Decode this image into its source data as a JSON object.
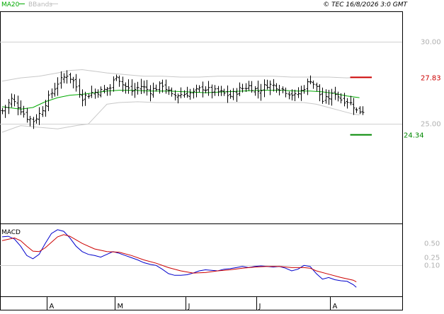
{
  "header": {
    "ma_legend": "MA20",
    "bbands_legend": "BBands",
    "copyright": "© TEC 16/8/2026 3:0 GMT"
  },
  "colors": {
    "ma": "#00aa00",
    "bbands": "#c8c8c8",
    "bars": "#000000",
    "resistance": "#cc0000",
    "support": "#008800",
    "macd": "#0000cc",
    "signal": "#cc0000",
    "grid": "#d0d0d0",
    "axis_text": "#b0b0b0"
  },
  "chart_data": [
    {
      "type": "ohlc",
      "y_ticks": [
        "30.00",
        "25.00"
      ],
      "ylim": [
        19.0,
        31.8
      ],
      "month_labels": [
        "A",
        "M",
        "J",
        "J",
        "A"
      ],
      "month_positions": [
        14.5,
        36.5,
        59.5,
        82.5,
        106.5
      ],
      "bar_count": 118,
      "resistance": {
        "value": 27.83,
        "label": "27.83",
        "from_index": 113,
        "to_index": 120
      },
      "support": {
        "value": 24.34,
        "label": "24.34",
        "from_index": 113,
        "to_index": 120
      },
      "ma20": [
        [
          0,
          26.05
        ],
        [
          6,
          25.9
        ],
        [
          10,
          26.0
        ],
        [
          14,
          26.35
        ],
        [
          18,
          26.6
        ],
        [
          22,
          26.75
        ],
        [
          26,
          26.8
        ],
        [
          30,
          26.9
        ],
        [
          34,
          27.0
        ],
        [
          38,
          27.05
        ],
        [
          42,
          27.05
        ],
        [
          48,
          27.0
        ],
        [
          54,
          27.0
        ],
        [
          60,
          26.95
        ],
        [
          66,
          26.9
        ],
        [
          72,
          26.95
        ],
        [
          78,
          27.0
        ],
        [
          84,
          27.05
        ],
        [
          90,
          27.05
        ],
        [
          96,
          27.0
        ],
        [
          100,
          27.0
        ],
        [
          104,
          26.95
        ],
        [
          108,
          26.85
        ],
        [
          112,
          26.7
        ],
        [
          116,
          26.6
        ]
      ],
      "bb_upper": [
        [
          0,
          27.6
        ],
        [
          6,
          27.8
        ],
        [
          12,
          27.9
        ],
        [
          18,
          28.1
        ],
        [
          22,
          28.25
        ],
        [
          26,
          28.3
        ],
        [
          30,
          28.2
        ],
        [
          34,
          28.1
        ],
        [
          40,
          28.0
        ],
        [
          46,
          27.9
        ],
        [
          52,
          27.9
        ],
        [
          58,
          27.85
        ],
        [
          64,
          27.85
        ],
        [
          70,
          27.9
        ],
        [
          76,
          27.9
        ],
        [
          82,
          27.9
        ],
        [
          88,
          27.9
        ],
        [
          94,
          27.85
        ],
        [
          100,
          27.85
        ],
        [
          106,
          27.85
        ],
        [
          112,
          27.8
        ],
        [
          116,
          27.85
        ]
      ],
      "bb_lower": [
        [
          0,
          24.5
        ],
        [
          6,
          24.9
        ],
        [
          12,
          24.8
        ],
        [
          18,
          24.7
        ],
        [
          24,
          24.9
        ],
        [
          28,
          25.0
        ],
        [
          32,
          25.8
        ],
        [
          34,
          26.2
        ],
        [
          38,
          26.3
        ],
        [
          44,
          26.35
        ],
        [
          50,
          26.3
        ],
        [
          56,
          26.3
        ],
        [
          62,
          26.3
        ],
        [
          68,
          26.3
        ],
        [
          74,
          26.3
        ],
        [
          80,
          26.3
        ],
        [
          86,
          26.3
        ],
        [
          92,
          26.3
        ],
        [
          98,
          26.3
        ],
        [
          102,
          26.2
        ],
        [
          106,
          26.0
        ],
        [
          110,
          25.8
        ],
        [
          114,
          25.6
        ],
        [
          116,
          25.55
        ]
      ],
      "close_path": [
        [
          0,
          25.8
        ],
        [
          3,
          26.5
        ],
        [
          5,
          26.1
        ],
        [
          8,
          25.4
        ],
        [
          10,
          25.2
        ],
        [
          12,
          25.6
        ],
        [
          15,
          26.6
        ],
        [
          18,
          27.5
        ],
        [
          21,
          28.0
        ],
        [
          23,
          27.6
        ],
        [
          26,
          26.6
        ],
        [
          29,
          26.9
        ],
        [
          32,
          27.0
        ],
        [
          35,
          27.2
        ],
        [
          37,
          28.0
        ],
        [
          39,
          27.4
        ],
        [
          42,
          27.0
        ],
        [
          45,
          27.3
        ],
        [
          48,
          27.0
        ],
        [
          52,
          27.4
        ],
        [
          55,
          26.7
        ],
        [
          58,
          26.8
        ],
        [
          62,
          26.9
        ],
        [
          65,
          27.2
        ],
        [
          68,
          27.0
        ],
        [
          71,
          26.9
        ],
        [
          74,
          26.7
        ],
        [
          77,
          27.1
        ],
        [
          80,
          27.3
        ],
        [
          83,
          27.0
        ],
        [
          86,
          27.4
        ],
        [
          89,
          27.3
        ],
        [
          92,
          27.0
        ],
        [
          95,
          26.7
        ],
        [
          97,
          27.0
        ],
        [
          100,
          27.7
        ],
        [
          102,
          27.2
        ],
        [
          104,
          26.4
        ],
        [
          106,
          26.6
        ],
        [
          108,
          26.9
        ],
        [
          110,
          26.5
        ],
        [
          112,
          26.4
        ],
        [
          114,
          26.1
        ],
        [
          115,
          25.8
        ]
      ]
    },
    {
      "type": "line",
      "title": "MACD",
      "y_ticks": [
        "0.50",
        "0.25",
        "0.10"
      ],
      "ylim": [
        -0.45,
        0.85
      ],
      "series": [
        {
          "key": "macd",
          "points": [
            [
              0,
              0.62
            ],
            [
              2,
              0.63
            ],
            [
              4,
              0.58
            ],
            [
              6,
              0.45
            ],
            [
              8,
              0.28
            ],
            [
              10,
              0.22
            ],
            [
              12,
              0.3
            ],
            [
              14,
              0.5
            ],
            [
              16,
              0.68
            ],
            [
              18,
              0.75
            ],
            [
              20,
              0.72
            ],
            [
              22,
              0.6
            ],
            [
              24,
              0.45
            ],
            [
              26,
              0.35
            ],
            [
              28,
              0.3
            ],
            [
              30,
              0.28
            ],
            [
              32,
              0.25
            ],
            [
              34,
              0.3
            ],
            [
              36,
              0.35
            ],
            [
              38,
              0.32
            ],
            [
              40,
              0.28
            ],
            [
              42,
              0.24
            ],
            [
              44,
              0.2
            ],
            [
              46,
              0.15
            ],
            [
              48,
              0.12
            ],
            [
              50,
              0.1
            ],
            [
              52,
              0.03
            ],
            [
              54,
              -0.05
            ],
            [
              56,
              -0.08
            ],
            [
              58,
              -0.08
            ],
            [
              60,
              -0.07
            ],
            [
              62,
              -0.04
            ],
            [
              64,
              0.0
            ],
            [
              66,
              0.02
            ],
            [
              68,
              0.01
            ],
            [
              70,
              0.0
            ],
            [
              72,
              0.03
            ],
            [
              74,
              0.04
            ],
            [
              76,
              0.06
            ],
            [
              78,
              0.08
            ],
            [
              80,
              0.06
            ],
            [
              82,
              0.08
            ],
            [
              84,
              0.09
            ],
            [
              86,
              0.08
            ],
            [
              88,
              0.07
            ],
            [
              90,
              0.08
            ],
            [
              92,
              0.05
            ],
            [
              94,
              0.0
            ],
            [
              96,
              0.03
            ],
            [
              98,
              0.1
            ],
            [
              100,
              0.08
            ],
            [
              102,
              -0.05
            ],
            [
              104,
              -0.15
            ],
            [
              106,
              -0.12
            ],
            [
              108,
              -0.16
            ],
            [
              110,
              -0.18
            ],
            [
              112,
              -0.19
            ],
            [
              114,
              -0.25
            ],
            [
              115,
              -0.3
            ]
          ]
        },
        {
          "key": "signal",
          "points": [
            [
              0,
              0.55
            ],
            [
              4,
              0.6
            ],
            [
              6,
              0.55
            ],
            [
              8,
              0.45
            ],
            [
              10,
              0.36
            ],
            [
              12,
              0.35
            ],
            [
              14,
              0.42
            ],
            [
              16,
              0.52
            ],
            [
              18,
              0.62
            ],
            [
              20,
              0.66
            ],
            [
              22,
              0.63
            ],
            [
              26,
              0.5
            ],
            [
              30,
              0.4
            ],
            [
              34,
              0.35
            ],
            [
              38,
              0.34
            ],
            [
              42,
              0.28
            ],
            [
              46,
              0.2
            ],
            [
              50,
              0.14
            ],
            [
              54,
              0.06
            ],
            [
              58,
              0.0
            ],
            [
              62,
              -0.04
            ],
            [
              66,
              -0.03
            ],
            [
              70,
              0.0
            ],
            [
              74,
              0.02
            ],
            [
              78,
              0.05
            ],
            [
              82,
              0.07
            ],
            [
              86,
              0.08
            ],
            [
              90,
              0.08
            ],
            [
              94,
              0.06
            ],
            [
              98,
              0.06
            ],
            [
              100,
              0.05
            ],
            [
              102,
              0.0
            ],
            [
              106,
              -0.06
            ],
            [
              110,
              -0.12
            ],
            [
              114,
              -0.17
            ],
            [
              115,
              -0.2
            ]
          ]
        }
      ]
    }
  ]
}
